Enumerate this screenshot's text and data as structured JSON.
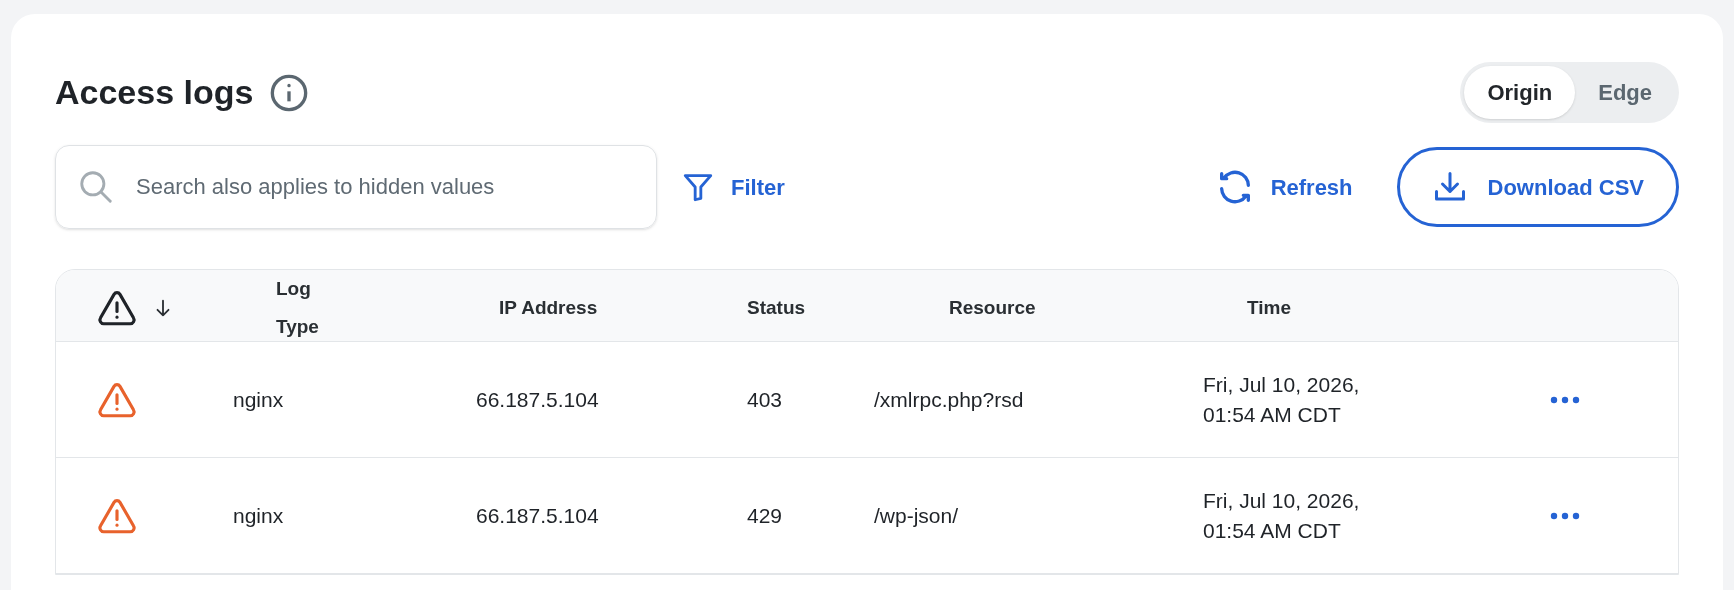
{
  "header": {
    "title": "Access logs"
  },
  "view_toggle": [
    {
      "label": "Origin",
      "selected": true
    },
    {
      "label": "Edge",
      "selected": false
    }
  ],
  "search": {
    "placeholder": "Search also applies to hidden values"
  },
  "actions": {
    "filter": "Filter",
    "refresh": "Refresh",
    "download": "Download CSV"
  },
  "table": {
    "columns": [
      "Log Type",
      "IP Address",
      "Status",
      "Resource",
      "Time"
    ],
    "rows": [
      {
        "log_type": "nginx",
        "ip": "66.187.5.104",
        "status": "403",
        "resource": "/xmlrpc.php?rsd",
        "time": "Fri, Jul 10, 2026, 01:54 AM CDT"
      },
      {
        "log_type": "nginx",
        "ip": "66.187.5.104",
        "status": "429",
        "resource": "/wp-json/",
        "time": "Fri, Jul 10, 2026, 01:54 AM CDT"
      }
    ]
  }
}
